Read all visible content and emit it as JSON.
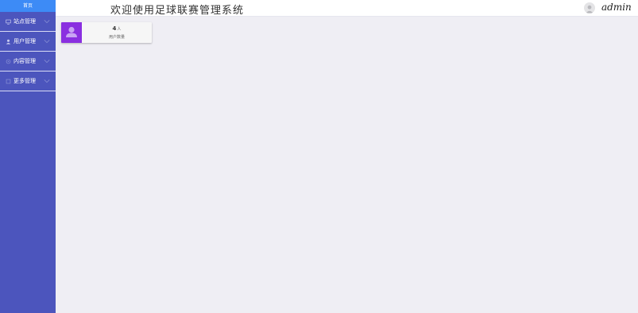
{
  "sidebar": {
    "home_label": "首页",
    "items": [
      {
        "label": "站点管理",
        "icon": "monitor-icon"
      },
      {
        "label": "用户管理",
        "icon": "user-icon"
      },
      {
        "label": "内容管理",
        "icon": "content-icon"
      },
      {
        "label": "更多管理",
        "icon": "more-icon"
      }
    ]
  },
  "header": {
    "welcome": "欢迎使用足球联赛管理系统",
    "username": "admin",
    "avatar_icon": "user-avatar-icon"
  },
  "stats": [
    {
      "value": "4",
      "unit": "人",
      "label": "用户数量",
      "icon": "user-icon",
      "color": "#8a2fe0"
    }
  ],
  "colors": {
    "sidebar_bg": "#4c55bd",
    "home_bg": "#3d8bf6",
    "content_bg": "#efeef4",
    "stat_accent": "#8a2fe0"
  }
}
